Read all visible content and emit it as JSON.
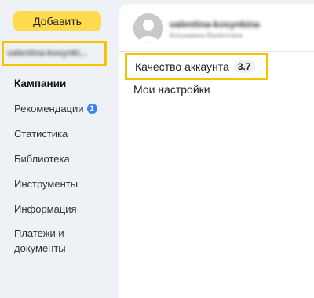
{
  "sidebar": {
    "add_button": "Добавить",
    "account_login": "valentina-kosynki...",
    "items": [
      {
        "label": "Кампании",
        "active": true
      },
      {
        "label": "Рекомендации",
        "badge": "1"
      },
      {
        "label": "Статистика"
      },
      {
        "label": "Библиотека"
      },
      {
        "label": "Инструменты"
      },
      {
        "label": "Информация"
      },
      {
        "label": "Платежи и документы"
      }
    ]
  },
  "panel": {
    "user_login": "valentina-kosynkina",
    "user_full_name": "Косынкина Валентина",
    "menu": {
      "account_quality_label": "Качество аккаунта",
      "account_quality_score": "3.7",
      "my_settings_label": "Мои настройки"
    }
  },
  "colors": {
    "accent_yellow": "#ffdb4d",
    "highlight_border": "#f5c400",
    "badge_blue": "#3b82f6",
    "sidebar_bg": "#eef1f5"
  }
}
